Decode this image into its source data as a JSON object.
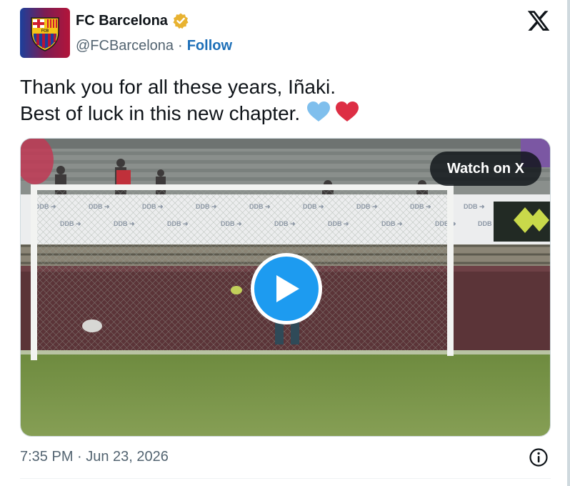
{
  "author": {
    "name": "FC Barcelona",
    "handle": "@FCBarcelona",
    "separator": "·",
    "follow_label": "Follow",
    "crest_text": "FCB"
  },
  "icons": {
    "platform": "x-logo-icon",
    "verified": "verified-badge-icon",
    "play": "play-icon",
    "info": "info-icon"
  },
  "tweet": {
    "line1": "Thank you for all these years, Iñaki.",
    "line2": "Best of luck in this new chapter.",
    "emojis": [
      "light-blue-heart",
      "red-heart"
    ]
  },
  "media": {
    "watch_label": "Watch on X"
  },
  "footer": {
    "timestamp": "7:35 PM · Jun 23, 2026"
  },
  "colors": {
    "follow": "#1d6fb8",
    "play": "#1d9bf0",
    "verified": "#e8b230",
    "heart_blue": "#7fbfed",
    "heart_red": "#dd2e44"
  }
}
